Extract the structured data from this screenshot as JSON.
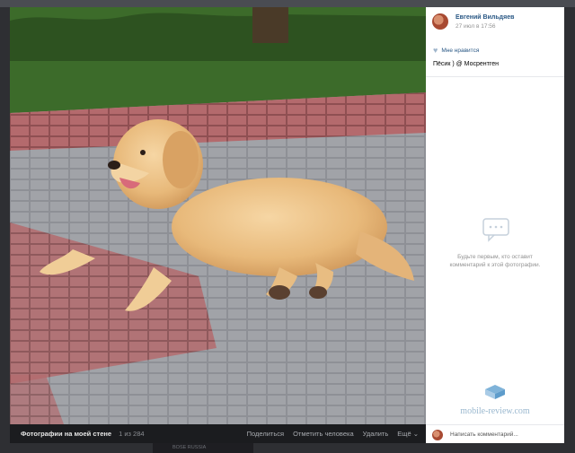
{
  "author": {
    "name": "Евгений Вильдяев",
    "time": "27 июл в 17:56"
  },
  "like_label": "Мне нравится",
  "caption": "Пёсик ) @ Мосрентген",
  "empty_comments": {
    "line1": "Будьте первым, кто оставит",
    "line2": "комментарий к этой фотографии."
  },
  "watermark": "mobile-review.com",
  "comment_placeholder": "Написать комментарий...",
  "photo_bar": {
    "album": "Фотографии на моей стене",
    "counter": "1 из 284",
    "actions": [
      "Поделиться",
      "Отметить человека",
      "Удалить",
      "Ещё ⌄"
    ]
  },
  "below_text": "BOSE RUSSIA",
  "icons": [
    "heart-icon",
    "comments-empty-icon",
    "watermark-logo-icon",
    "avatar"
  ],
  "colors": {
    "link": "#2a5885",
    "muted": "#939393",
    "bar": "#1b1c1f"
  }
}
